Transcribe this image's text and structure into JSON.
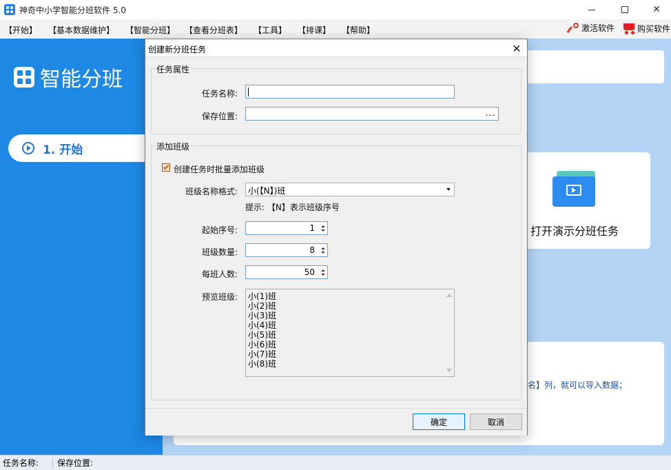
{
  "window": {
    "title": "神奇中小学智能分班软件 5.0"
  },
  "menu": {
    "items": [
      "【开始】",
      "【基本数据维护】",
      "【智能分班】",
      "【查看分班表】",
      "【工具】",
      "【排课】",
      "【帮助】"
    ],
    "activate": "激活软件",
    "buy": "购买软件"
  },
  "sidebar": {
    "brand": "智能分班",
    "start_item": "1. 开始"
  },
  "main": {
    "open_demo": "打开演示分班任务",
    "import_hint": "名】列，就可以导入数据；"
  },
  "statusbar": {
    "task_name_label": "任务名称:",
    "save_location_label": "保存位置:"
  },
  "dialog": {
    "title": "创建新分班任务",
    "task_props": {
      "group_title": "任务属性",
      "task_name_label": "任务名称:",
      "task_name_value": "",
      "save_location_label": "保存位置:",
      "save_location_value": "",
      "browse": "..."
    },
    "add_classes": {
      "group_title": "添加班级",
      "batch_add_label": "创建任务时批量添加班级",
      "batch_add_checked": true,
      "name_format_label": "班级名称格式:",
      "name_format_value": "小(【N】)班",
      "hint": "提示: 【N】表示班级序号",
      "start_no_label": "起始序号:",
      "start_no_value": "1",
      "class_count_label": "班级数量:",
      "class_count_value": "8",
      "per_class_label": "每班人数:",
      "per_class_value": "50",
      "preview_label": "预览班级:",
      "preview_items": [
        "小(1)班",
        "小(2)班",
        "小(3)班",
        "小(4)班",
        "小(5)班",
        "小(6)班",
        "小(7)班",
        "小(8)班"
      ]
    },
    "ok_label": "确定",
    "cancel_label": "取消"
  }
}
